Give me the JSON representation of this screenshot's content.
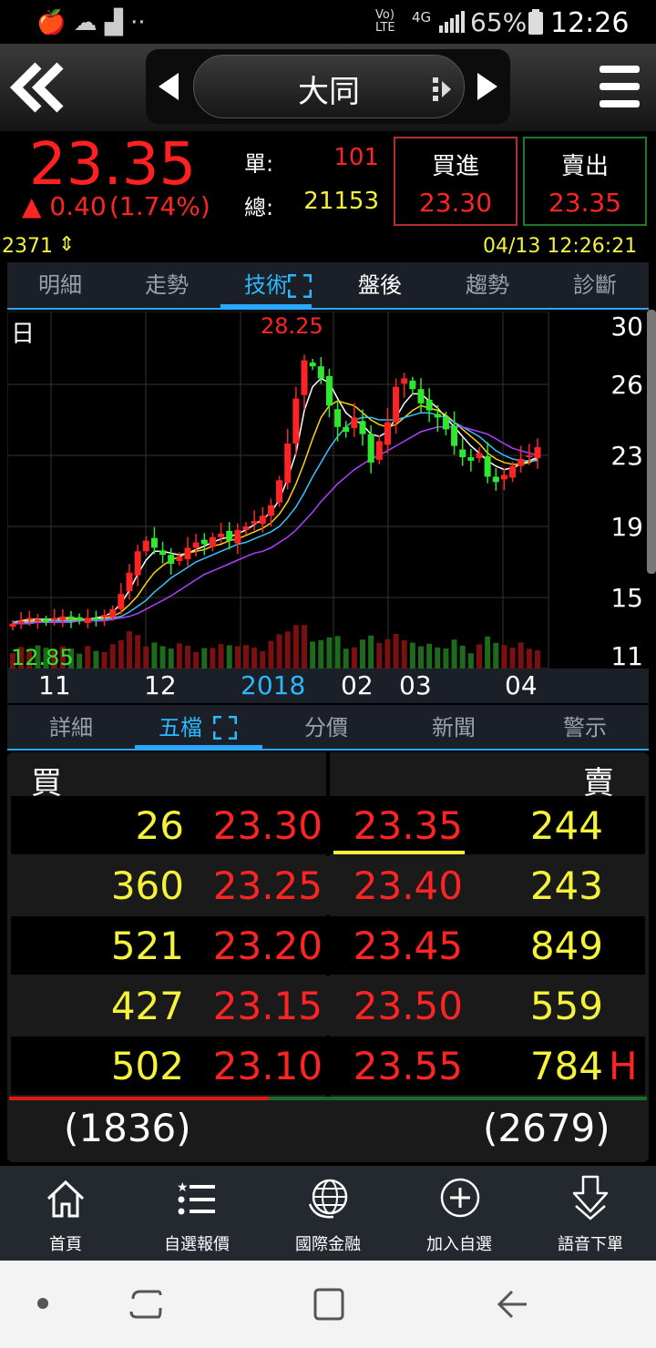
{
  "status_bar": {
    "network": "Vo) LTE",
    "signal": "4G",
    "battery": "65%",
    "time": "12:26"
  },
  "header": {
    "stock_name": "大同"
  },
  "quote": {
    "price": "23.35",
    "change": "▲ 0.40",
    "change_pct": "(1.74%)",
    "single_label": "單:",
    "single_value": "101",
    "total_label": "總:",
    "total_value": "21153",
    "buy_label": "買進",
    "buy_price": "23.30",
    "sell_label": "賣出",
    "sell_price": "23.35",
    "code": "2371",
    "datetime": "04/13 12:26:21"
  },
  "main_tabs": [
    "明細",
    "走勢",
    "技術",
    "盤後",
    "趨勢",
    "診斷"
  ],
  "chart": {
    "period_label": "日",
    "high_label": "28.25",
    "low_label": "12.85",
    "y_ticks": [
      "30",
      "26",
      "23",
      "19",
      "15",
      "11"
    ],
    "x_ticks": [
      "11",
      "12",
      "2018",
      "02",
      "03",
      "04"
    ]
  },
  "chart_data": {
    "type": "candlestick",
    "period": "日",
    "y_ticks": [
      30,
      26,
      23,
      19,
      15,
      11
    ],
    "x_ticks": [
      "11",
      "12",
      "2018",
      "02",
      "03",
      "04"
    ],
    "ylim": [
      11,
      30
    ],
    "high": 28.25,
    "low": 12.85,
    "close_series": [
      13.2,
      13.4,
      13.6,
      13.5,
      13.3,
      13.6,
      13.7,
      13.5,
      13.4,
      13.6,
      13.5,
      13.8,
      14.2,
      15.2,
      16.4,
      17.6,
      18.2,
      17.8,
      17.4,
      16.9,
      17.3,
      17.8,
      18.1,
      18.0,
      18.4,
      18.6,
      18.2,
      18.8,
      19.0,
      19.3,
      19.6,
      20.2,
      21.6,
      23.5,
      25.4,
      27.6,
      27.2,
      26.4,
      25.1,
      24.2,
      24.0,
      24.6,
      23.9,
      22.6,
      23.6,
      24.4,
      25.9,
      26.4,
      25.8,
      25.2,
      24.9,
      24.6,
      24.1,
      23.4,
      22.9,
      22.7,
      23.1,
      21.8,
      21.5,
      21.9,
      22.4,
      22.8,
      23.0,
      23.35
    ],
    "ma_series": [
      {
        "color": "#ffffff",
        "values": [
          13.3,
          13.4,
          13.5,
          13.5,
          13.5,
          13.5,
          13.6,
          13.6,
          13.5,
          13.5,
          13.6,
          13.7,
          14.0,
          14.6,
          15.4,
          16.3,
          17.1,
          17.6,
          17.6,
          17.5,
          17.4,
          17.5,
          17.7,
          17.9,
          18.1,
          18.3,
          18.4,
          18.6,
          18.8,
          19.1,
          19.4,
          19.8,
          20.5,
          21.7,
          23.1,
          24.9,
          25.9,
          26.4,
          26.1,
          25.4,
          24.8,
          24.5,
          24.3,
          23.9,
          23.8,
          24.0,
          24.6,
          25.2,
          25.6,
          25.6,
          25.3,
          25.0,
          24.6,
          24.2,
          23.8,
          23.4,
          23.1,
          22.7,
          22.4,
          22.2,
          22.3,
          22.5,
          22.7,
          22.9
        ]
      },
      {
        "color": "#ffd200",
        "values": [
          13.3,
          13.3,
          13.4,
          13.4,
          13.4,
          13.5,
          13.5,
          13.5,
          13.5,
          13.5,
          13.5,
          13.6,
          13.7,
          14.0,
          14.5,
          15.1,
          15.8,
          16.4,
          16.8,
          17.1,
          17.3,
          17.5,
          17.6,
          17.7,
          17.9,
          18.0,
          18.2,
          18.3,
          18.5,
          18.7,
          18.9,
          19.2,
          19.7,
          20.4,
          21.4,
          22.6,
          23.7,
          24.6,
          25.1,
          25.3,
          25.2,
          25.1,
          24.8,
          24.5,
          24.3,
          24.2,
          24.3,
          24.6,
          24.9,
          25.1,
          25.0,
          24.9,
          24.7,
          24.4,
          24.1,
          23.8,
          23.5,
          23.1,
          22.8,
          22.6,
          22.5,
          22.5,
          22.6,
          22.8
        ]
      },
      {
        "color": "#35c4ff",
        "values": [
          13.3,
          13.3,
          13.3,
          13.3,
          13.4,
          13.4,
          13.4,
          13.4,
          13.4,
          13.5,
          13.5,
          13.5,
          13.6,
          13.7,
          14.0,
          14.4,
          14.8,
          15.3,
          15.7,
          16.1,
          16.4,
          16.7,
          17.0,
          17.2,
          17.4,
          17.6,
          17.8,
          18.0,
          18.1,
          18.3,
          18.5,
          18.7,
          19.0,
          19.5,
          20.1,
          20.9,
          21.8,
          22.6,
          23.3,
          23.8,
          24.2,
          24.5,
          24.6,
          24.6,
          24.5,
          24.5,
          24.5,
          24.6,
          24.7,
          24.8,
          24.8,
          24.7,
          24.6,
          24.4,
          24.2,
          24.0,
          23.8,
          23.5,
          23.2,
          23.0,
          22.8,
          22.7,
          22.7,
          22.7
        ]
      },
      {
        "color": "#b040ff",
        "values": [
          13.2,
          13.2,
          13.2,
          13.3,
          13.3,
          13.3,
          13.3,
          13.3,
          13.4,
          13.4,
          13.4,
          13.4,
          13.5,
          13.6,
          13.7,
          13.9,
          14.2,
          14.5,
          14.8,
          15.1,
          15.4,
          15.7,
          16.0,
          16.3,
          16.5,
          16.7,
          16.9,
          17.1,
          17.3,
          17.5,
          17.6,
          17.8,
          18.1,
          18.4,
          18.8,
          19.3,
          19.8,
          20.4,
          20.9,
          21.4,
          21.8,
          22.2,
          22.5,
          22.8,
          23.0,
          23.2,
          23.4,
          23.6,
          23.8,
          24.0,
          24.1,
          24.2,
          24.2,
          24.2,
          24.2,
          24.1,
          24.0,
          23.9,
          23.7,
          23.5,
          23.3,
          23.2,
          23.1,
          23.0
        ]
      }
    ]
  },
  "sub_tabs": [
    "詳細",
    "五檔",
    "分價",
    "新聞",
    "警示"
  ],
  "order_book": {
    "buy_label": "買",
    "sell_label": "賣",
    "bids": [
      {
        "qty": "26",
        "price": "23.30"
      },
      {
        "qty": "360",
        "price": "23.25"
      },
      {
        "qty": "521",
        "price": "23.20"
      },
      {
        "qty": "427",
        "price": "23.15"
      },
      {
        "qty": "502",
        "price": "23.10"
      }
    ],
    "asks": [
      {
        "price": "23.35",
        "qty": "244"
      },
      {
        "price": "23.40",
        "qty": "243"
      },
      {
        "price": "23.45",
        "qty": "849"
      },
      {
        "price": "23.50",
        "qty": "559"
      },
      {
        "price": "23.55",
        "qty": "784"
      }
    ],
    "high_marker": "H",
    "bid_total": "(1836)",
    "ask_total": "(2679)",
    "bid_ratio": 0.407
  },
  "bottom_nav": [
    "首頁",
    "自選報價",
    "國際金融",
    "加入自選",
    "語音下單"
  ],
  "colors": {
    "up": "#ff2424",
    "down": "#2ee82e",
    "accent": "#2aa7ff",
    "volume_text": "#f5f23a"
  }
}
